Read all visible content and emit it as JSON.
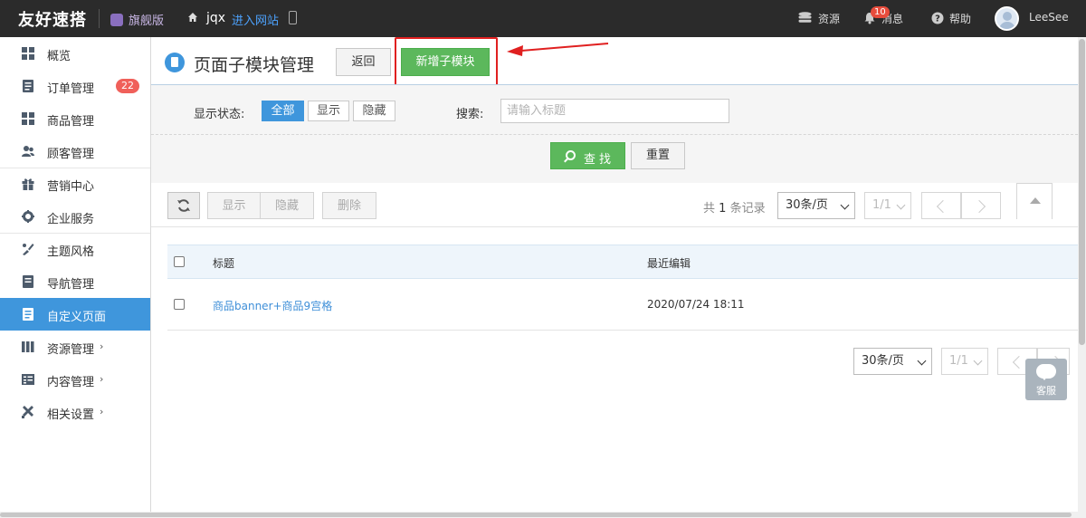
{
  "topbar": {
    "brand": "友好速搭",
    "edition": "旗舰版",
    "site_name": "jqx",
    "site_link": "进入网站",
    "resources": "资源",
    "messages": "消息",
    "messages_badge": "10",
    "help": "帮助",
    "username": "LeeSee"
  },
  "sidebar": {
    "items": [
      {
        "label": "概览",
        "icon": "dashboard-icon"
      },
      {
        "label": "订单管理",
        "icon": "order-icon",
        "badge": "22"
      },
      {
        "label": "商品管理",
        "icon": "product-icon"
      },
      {
        "label": "顾客管理",
        "icon": "customer-icon"
      },
      {
        "label": "营销中心",
        "icon": "gift-icon"
      },
      {
        "label": "企业服务",
        "icon": "gear-icon"
      },
      {
        "label": "主题风格",
        "icon": "theme-icon"
      },
      {
        "label": "导航管理",
        "icon": "navigation-icon"
      },
      {
        "label": "自定义页面",
        "icon": "page-icon",
        "active": true
      },
      {
        "label": "资源管理",
        "icon": "resource-icon",
        "chevron": "›"
      },
      {
        "label": "内容管理",
        "icon": "content-icon",
        "chevron": "›"
      },
      {
        "label": "相关设置",
        "icon": "tools-icon",
        "chevron": "›"
      }
    ]
  },
  "header": {
    "title": "页面子模块管理",
    "back_label": "返回",
    "add_label": "新增子模块"
  },
  "filter": {
    "status_label": "显示状态:",
    "status_options": [
      "全部",
      "显示",
      "隐藏"
    ],
    "status_selected": "全部",
    "search_label": "搜索:",
    "search_placeholder": "请输入标题",
    "find_label": "查找",
    "reset_label": "重置"
  },
  "toolbar": {
    "show_label": "显示",
    "hide_label": "隐藏",
    "delete_label": "删除",
    "record_prefix": "共",
    "record_count": "1",
    "record_suffix": "条记录",
    "page_size": "30条/页",
    "page_indicator": "1/1"
  },
  "table": {
    "columns": [
      "标题",
      "最近编辑"
    ],
    "rows": [
      {
        "title": "商品banner+商品9宫格",
        "edited": "2020/07/24 18:11"
      }
    ]
  },
  "footer_pager": {
    "page_size": "30条/页",
    "page_indicator": "1/1"
  },
  "chat": {
    "label": "客服"
  },
  "colors": {
    "accent": "#3f96dc",
    "primary_green": "#5cb85c",
    "highlight_red": "#e02020",
    "topbar_bg": "#2b2b2b"
  }
}
